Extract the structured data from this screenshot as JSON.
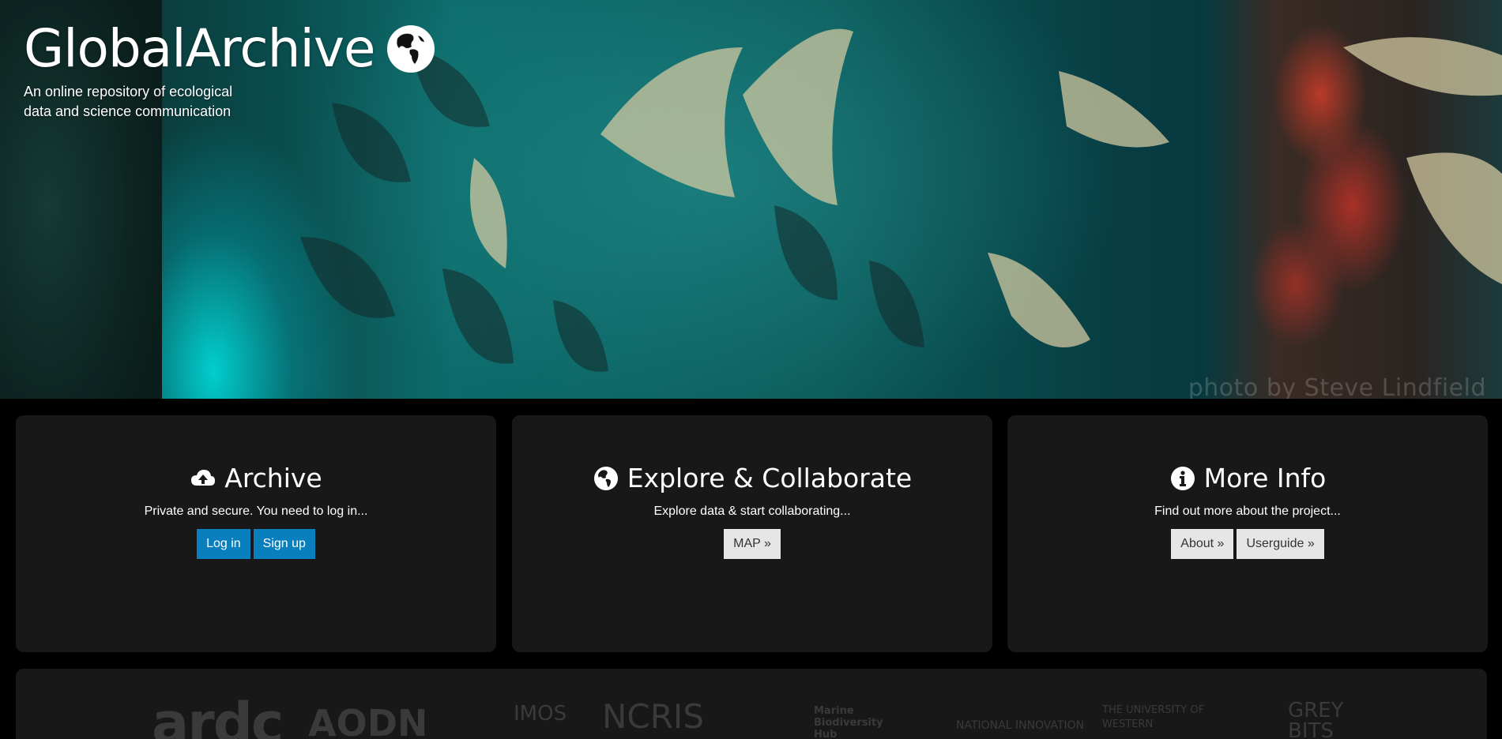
{
  "brand": {
    "title": "GlobalArchive",
    "tagline": "An online repository of ecological data and science communication",
    "icon": "globe-icon"
  },
  "hero": {
    "photo_credit": "photo by Steve Lindfield"
  },
  "panels": [
    {
      "title": "Archive",
      "icon": "cloud-upload-icon",
      "description": "Private and secure. You need to log in...",
      "buttons": [
        {
          "label": "Log in",
          "style": "primary"
        },
        {
          "label": "Sign up",
          "style": "primary"
        }
      ]
    },
    {
      "title": "Explore & Collaborate",
      "icon": "globe-icon",
      "description": "Explore data & start collaborating...",
      "buttons": [
        {
          "label": "MAP »",
          "style": "light"
        }
      ]
    },
    {
      "title": "More Info",
      "icon": "info-circle-icon",
      "description": "Find out more about the project...",
      "buttons": [
        {
          "label": "About »",
          "style": "light"
        },
        {
          "label": "Userguide »",
          "style": "light"
        }
      ]
    }
  ],
  "footer_logos": [
    {
      "name": "ardc-logo",
      "text": "ardc"
    },
    {
      "name": "aodn-logo",
      "text": "AODN"
    },
    {
      "name": "imos-logo",
      "text": "IMOS"
    },
    {
      "name": "ncris-logo",
      "text": "NCRIS"
    },
    {
      "name": "marine-biodiversity-hub-logo",
      "text": "Marine Biodiversity Hub"
    },
    {
      "name": "national-innovation-logo",
      "text": "NATIONAL INNOVATION"
    },
    {
      "name": "uwa-logo",
      "text": "THE UNIVERSITY OF WESTERN"
    },
    {
      "name": "grey-bits-logo",
      "text": "GREY BITS"
    }
  ],
  "colors": {
    "primary_button": "#0a7fbe",
    "light_button": "#e6e6e6",
    "panel_bg": "#181818",
    "page_bg": "#000000"
  }
}
